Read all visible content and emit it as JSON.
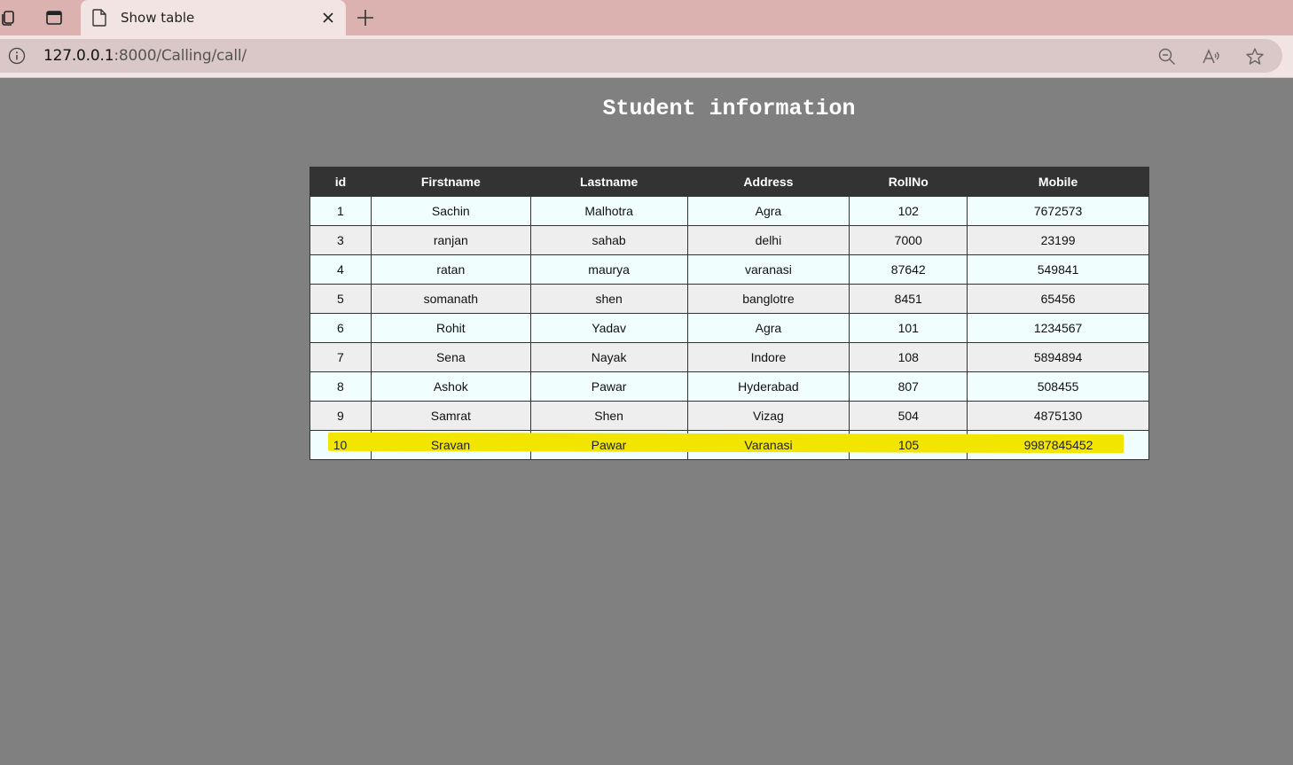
{
  "browser": {
    "tab": {
      "title": "Show table"
    },
    "address": {
      "host": "127.0.0.1",
      "path": ":8000/Calling/call/"
    }
  },
  "page": {
    "title": "Student information"
  },
  "table": {
    "columns": [
      "id",
      "Firstname",
      "Lastname",
      "Address",
      "RollNo",
      "Mobile"
    ],
    "rows": [
      [
        "1",
        "Sachin",
        "Malhotra",
        "Agra",
        "102",
        "7672573"
      ],
      [
        "3",
        "ranjan",
        "sahab",
        "delhi",
        "7000",
        "23199"
      ],
      [
        "4",
        "ratan",
        "maurya",
        "varanasi",
        "87642",
        "549841"
      ],
      [
        "5",
        "somanath",
        "shen",
        "banglotre",
        "8451",
        "65456"
      ],
      [
        "6",
        "Rohit",
        "Yadav",
        "Agra",
        "101",
        "1234567"
      ],
      [
        "7",
        "Sena",
        "Nayak",
        "Indore",
        "108",
        "5894894"
      ],
      [
        "8",
        "Ashok",
        "Pawar",
        "Hyderabad",
        "807",
        "508455"
      ],
      [
        "9",
        "Samrat",
        "Shen",
        "Vizag",
        "504",
        "4875130"
      ],
      [
        "10",
        "Sravan",
        "Pawar",
        "Varanasi",
        "105",
        "9987845452"
      ]
    ],
    "highlighted_row": 8,
    "highlight_color": "#f2e600"
  },
  "colors": {
    "page_background": "#808080",
    "header_background": "#333333",
    "odd_row": "#f0fefe",
    "even_row": "#efeeee",
    "tabstrip": "#dbb2af"
  },
  "icons": {
    "tab_actions": "collections-icon",
    "vertical_tabs": "vertical-tabs-icon",
    "tab_page": "page-icon",
    "tab_close": "close-icon",
    "new_tab": "plus-icon",
    "site_info": "info-icon",
    "zoom": "zoom-out-icon",
    "read_aloud": "read-aloud-icon",
    "favorite": "star-icon"
  }
}
